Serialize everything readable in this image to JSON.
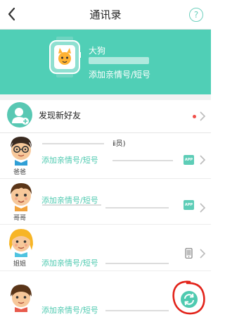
{
  "header": {
    "title": "通讯录",
    "help_label": "?"
  },
  "device": {
    "name": "大狗",
    "add_link": "添加亲情号/短号"
  },
  "discover": {
    "label": "发现新好友"
  },
  "contacts": [
    {
      "relation": "爸爸",
      "name": "ⅱ员)",
      "add_link": "添加亲情号/短号",
      "badge": "APP"
    },
    {
      "relation": "哥哥",
      "add_link": "添加亲情号/短号",
      "badge": "APP"
    },
    {
      "relation": "姐姐",
      "add_link": "添加亲情号/短号",
      "badge_icon": "phone-icon"
    },
    {
      "relation": "",
      "add_link": "添加亲情号/短号",
      "badge_icon": "sync-icon"
    }
  ],
  "colors": {
    "accent": "#50cfb6",
    "link": "#4fcab0",
    "dot": "#f0504a",
    "annotation": "#e2231a"
  }
}
